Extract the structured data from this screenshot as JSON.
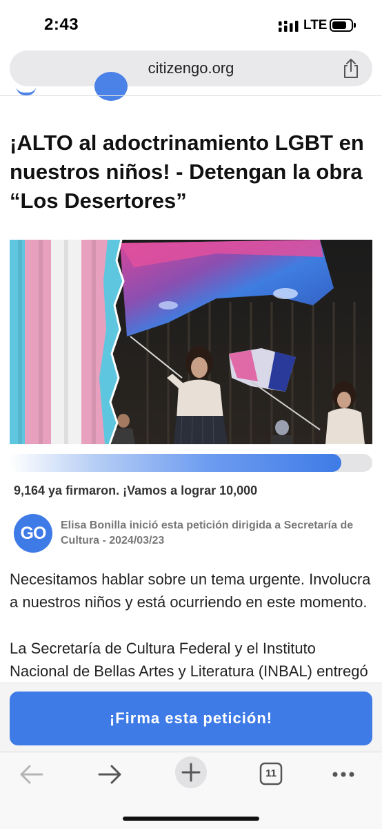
{
  "status_bar": {
    "time": "2:43",
    "network": "LTE",
    "battery_level": 0.8
  },
  "browser": {
    "url": "citizengo.org",
    "tab_count": "11",
    "toolbar": {
      "back": "back-arrow-icon",
      "forward": "forward-arrow-icon",
      "new_tab": "plus-icon",
      "tabs": "tabs-icon",
      "more": "more-dots-icon"
    }
  },
  "petition": {
    "title": "¡ALTO al adoctrinamiento LGBT en nuestros niños! - Detengan la obra “Los Desertores”",
    "progress": 0.915,
    "signatures_text": "9,164 ya firmaron. ¡Vamos a lograr 10,000",
    "badge": "GO",
    "author_text": "Elisa Bonilla inició esta petición dirigida a Secretaría de Cultura - 2024/03/23",
    "body": [
      "Necesitamos hablar sobre un tema urgente. Involucra a nuestros niños y está ocurriendo en este momento.",
      "La Secretaría de Cultura Federal y el Instituto Nacional de Bellas Artes y Literatura (INBAL) entregó"
    ],
    "sign_button": "¡Firma esta petición!"
  },
  "colors": {
    "accent": "#3f7be6",
    "url_bar_bg": "#e9e9eb",
    "progress_track": "#e4e4e6"
  }
}
